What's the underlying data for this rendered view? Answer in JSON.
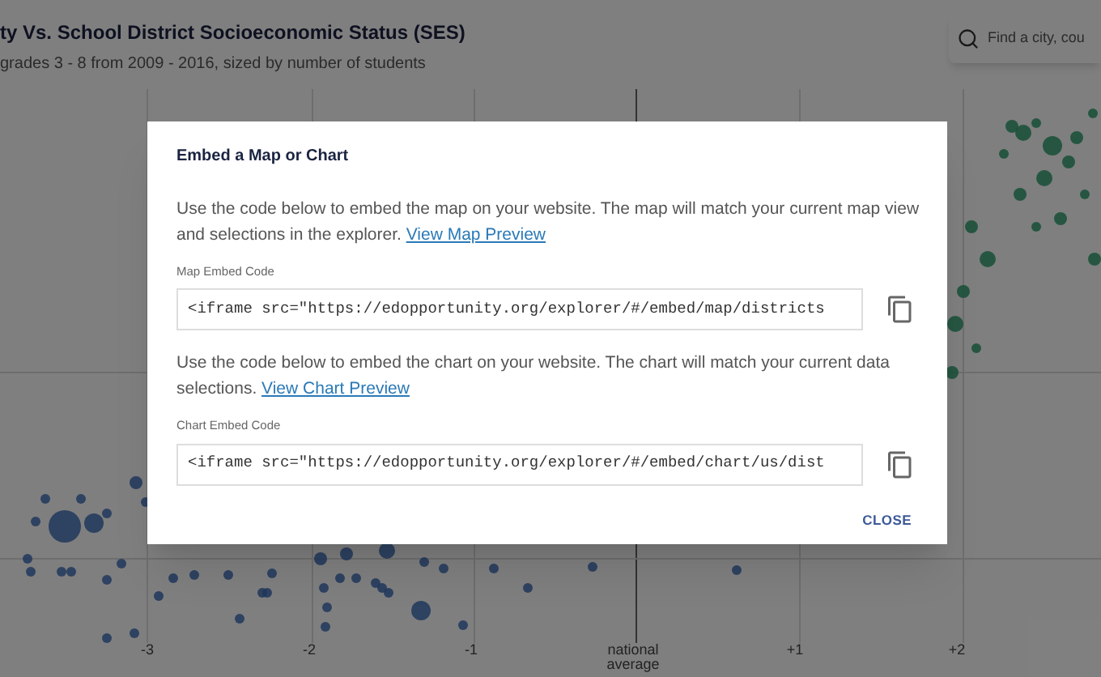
{
  "header": {
    "title": "ty Vs. School District Socioeconomic Status (SES)",
    "subtitle": "grades 3 - 8 from 2009 - 2016, sized by number of students"
  },
  "search": {
    "placeholder": "Find a city, cou"
  },
  "chart": {
    "axis_labels": [
      "-3",
      "-2",
      "-1",
      "national average",
      "+1",
      "+2"
    ]
  },
  "dialog": {
    "title": "Embed a Map or Chart",
    "sections": [
      {
        "description": "Use the code below to embed the map on your website. The map will match your current map view and selections in the explorer.",
        "link": "View Map Preview",
        "label": "Map Embed Code",
        "code": "<iframe src=\"https://edopportunity.org/explorer/#/embed/map/districts"
      },
      {
        "description": "Use the code below to embed the chart on your website. The chart will match your current data selections.",
        "link": "View Chart Preview",
        "label": "Chart Embed Code",
        "code": "<iframe src=\"https://edopportunity.org/explorer/#/embed/chart/us/dist"
      }
    ],
    "close": "CLOSE"
  }
}
